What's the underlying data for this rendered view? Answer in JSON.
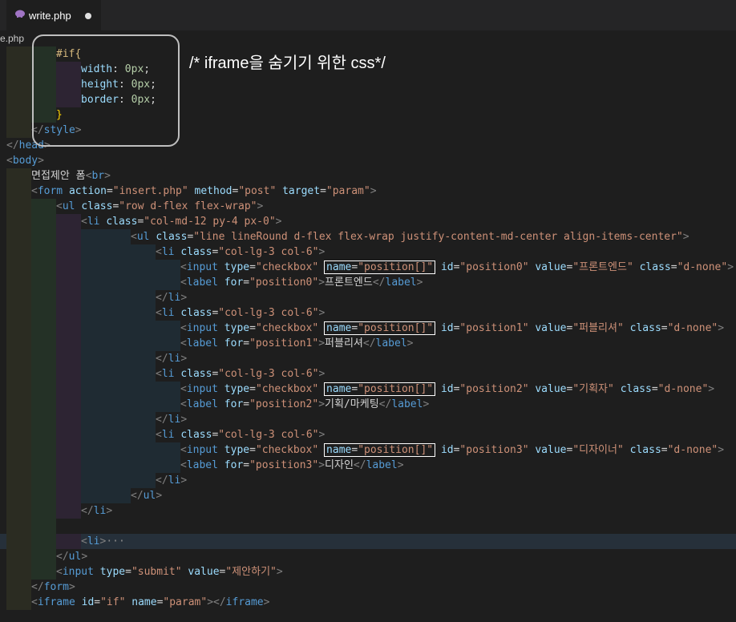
{
  "tab": {
    "label": "write.php",
    "icon": "php-elephant-icon"
  },
  "breadcrumb": "e.php",
  "annotation": "/* iframe을 숨기기 위한 css*/",
  "code": {
    "l01": [
      "#if{"
    ],
    "l02": [
      "width",
      ": ",
      "0px",
      ";"
    ],
    "l03": [
      "height",
      ": ",
      "0px",
      ";"
    ],
    "l04": [
      "border",
      ": ",
      "0px",
      ";"
    ],
    "l05": [
      "}"
    ],
    "l06": [
      "</",
      "style",
      ">"
    ],
    "l07": [
      "</",
      "head",
      ">"
    ],
    "l08": [
      "<",
      "body",
      ">"
    ],
    "l09": [
      "면접제안 폼",
      "<",
      "br",
      ">"
    ],
    "l10": [
      "<",
      "form",
      " ",
      "action",
      "=",
      "\"insert.php\"",
      " ",
      "method",
      "=",
      "\"post\"",
      " ",
      "target",
      "=",
      "\"param\"",
      ">"
    ],
    "l11": [
      "<",
      "ul",
      " ",
      "class",
      "=",
      "\"row d-flex flex-wrap\"",
      ">"
    ],
    "l12": [
      "<",
      "li",
      " ",
      "class",
      "=",
      "\"col-md-12 py-4 px-0\"",
      ">"
    ],
    "l13": [
      "<",
      "ul",
      " ",
      "class",
      "=",
      "\"line lineRound d-flex flex-wrap justify-content-md-center align-items-center\"",
      ">"
    ],
    "items": [
      {
        "id": "\"position0\"",
        "value": "\"프론트엔드\"",
        "label_for": "\"position0\"",
        "label_text": "프론트엔드"
      },
      {
        "id": "\"position1\"",
        "value": "\"퍼블리셔\"",
        "label_for": "\"position1\"",
        "label_text": "퍼블리셔"
      },
      {
        "id": "\"position2\"",
        "value": "\"기획자\"",
        "label_for": "\"position2\"",
        "label_text": "기획/마케팅"
      },
      {
        "id": "\"position3\"",
        "value": "\"디자이너\"",
        "label_for": "\"position3\"",
        "label_text": "디자인"
      }
    ],
    "li_open": [
      "<",
      "li",
      " ",
      "class",
      "=",
      "\"col-lg-3 col-6\"",
      ">"
    ],
    "input_pre": [
      "<",
      "input",
      " ",
      "type",
      "=",
      "\"checkbox\"",
      " "
    ],
    "input_name": [
      "name",
      "=",
      "\"position[]\""
    ],
    "input_mid": [
      " ",
      "id",
      "="
    ],
    "input_val": [
      " ",
      "value",
      "="
    ],
    "input_class": [
      " ",
      "class",
      "=",
      "\"d-none\"",
      ">"
    ],
    "label_open": [
      "<",
      "label",
      " ",
      "for",
      "=",
      ">"
    ],
    "label_close": [
      "</",
      "label",
      ">"
    ],
    "li_close": [
      "</",
      "li",
      ">"
    ],
    "ul_close": [
      "</",
      "ul",
      ">"
    ],
    "l_fold": [
      "<",
      "li",
      ">",
      "···"
    ],
    "l_submit": [
      "<",
      "input",
      " ",
      "type",
      "=",
      "\"submit\"",
      " ",
      "value",
      "=",
      "\"제안하기\"",
      ">"
    ],
    "l_form_close": [
      "</",
      "form",
      ">"
    ],
    "l_iframe": [
      "<",
      "iframe",
      " ",
      "id",
      "=",
      "\"if\"",
      " ",
      "name",
      "=",
      "\"param\"",
      ">",
      "</",
      "iframe",
      ">"
    ]
  }
}
